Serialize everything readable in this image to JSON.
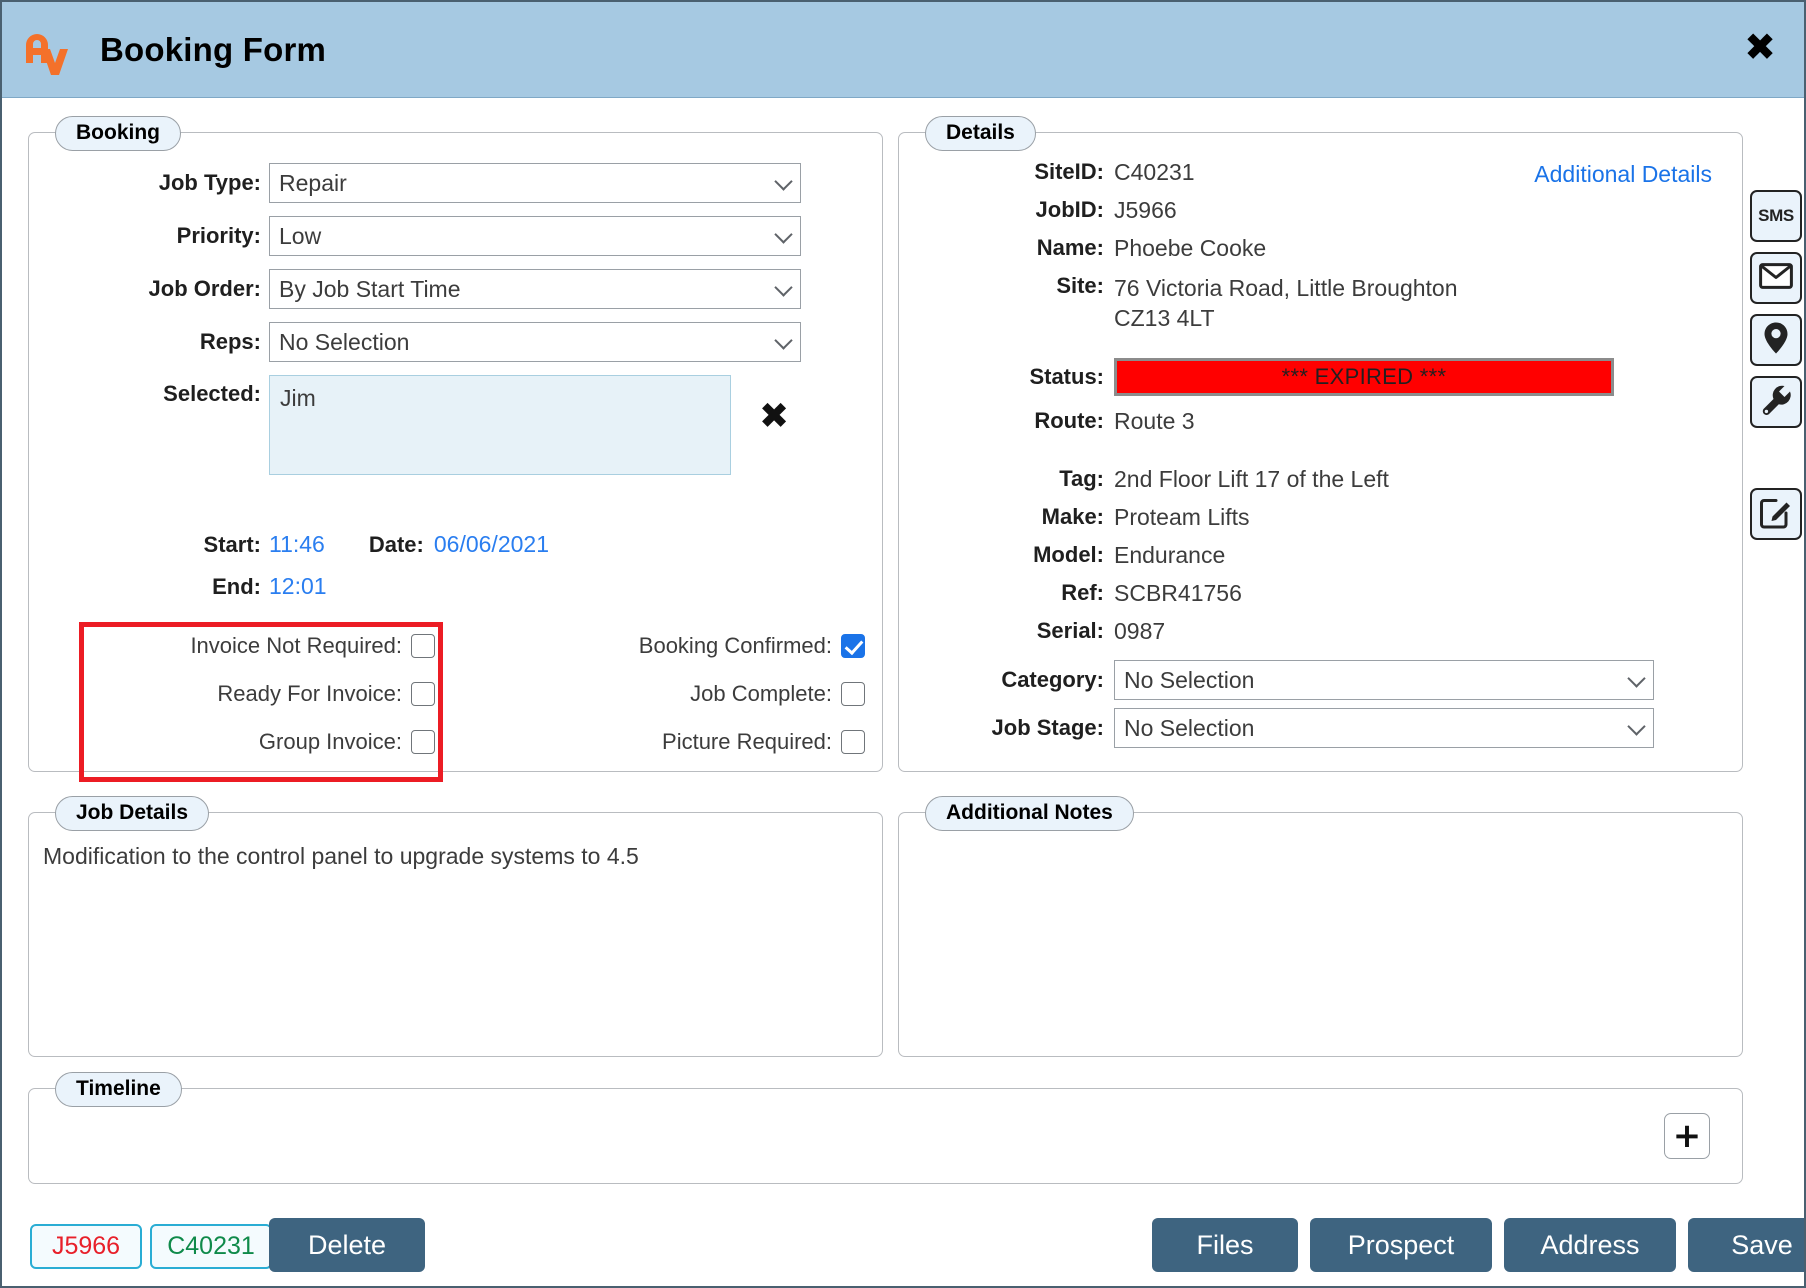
{
  "header": {
    "title": "Booking Form",
    "logo_alt": "AV logo",
    "close_label": "✖"
  },
  "booking": {
    "legend": "Booking",
    "fields": [
      {
        "label": "Job Type:",
        "value": "Repair"
      },
      {
        "label": "Priority:",
        "value": "Low"
      },
      {
        "label": "Job Order:",
        "value": "By Job Start Time"
      },
      {
        "label": "Reps:",
        "value": "No Selection"
      }
    ],
    "selected_label": "Selected:",
    "selected_value": "Jim",
    "clear_selected_label": "✖",
    "start_label": "Start:",
    "start_value": "11:46",
    "date_label": "Date:",
    "date_value": "06/06/2021",
    "end_label": "End:",
    "end_value": "12:01",
    "checkboxes_left": [
      {
        "label": "Invoice Not Required:",
        "checked": false
      },
      {
        "label": "Ready For Invoice:",
        "checked": false
      },
      {
        "label": "Group Invoice:",
        "checked": false
      }
    ],
    "checkboxes_right": [
      {
        "label": "Booking Confirmed:",
        "checked": true
      },
      {
        "label": "Job Complete:",
        "checked": false
      },
      {
        "label": "Picture Required:",
        "checked": false
      }
    ]
  },
  "details": {
    "legend": "Details",
    "additional_details_link": "Additional Details",
    "rows": [
      {
        "label": "SiteID:",
        "value": "C40231"
      },
      {
        "label": "JobID:",
        "value": "J5966"
      },
      {
        "label": "Name:",
        "value": "Phoebe Cooke"
      },
      {
        "label": "Site:",
        "value": "76 Victoria Road, Little Broughton\nCZ13 4LT"
      }
    ],
    "status_label": "Status:",
    "status_value": "*** EXPIRED ***",
    "status_color": "#ff0000",
    "route_label": "Route:",
    "route_value": "Route 3",
    "asset_rows": [
      {
        "label": "Tag:",
        "value": "2nd Floor Lift 17 of the Left"
      },
      {
        "label": "Make:",
        "value": "Proteam Lifts"
      },
      {
        "label": "Model:",
        "value": "Endurance"
      },
      {
        "label": "Ref:",
        "value": "SCBR41756"
      },
      {
        "label": "Serial:",
        "value": "0987"
      }
    ],
    "selects": [
      {
        "label": "Category:",
        "value": "No Selection"
      },
      {
        "label": "Job Stage:",
        "value": "No Selection"
      }
    ]
  },
  "job_details": {
    "legend": "Job Details",
    "text": "Modification to the control panel to upgrade systems to 4.5"
  },
  "additional_notes": {
    "legend": "Additional Notes",
    "text": ""
  },
  "timeline": {
    "legend": "Timeline",
    "add_label": "+"
  },
  "sidebar": {
    "items": [
      {
        "icon": "sms-icon",
        "label": "SMS"
      },
      {
        "icon": "envelope-icon",
        "label": ""
      },
      {
        "icon": "map-pin-icon",
        "label": ""
      },
      {
        "icon": "wrench-icon",
        "label": ""
      },
      {
        "icon": "edit-icon",
        "label": ""
      }
    ]
  },
  "footer": {
    "job_tag": "J5966",
    "site_tag": "C40231",
    "delete_label": "Delete",
    "files_label": "Files",
    "prospect_label": "Prospect",
    "address_label": "Address",
    "save_label": "Save"
  }
}
